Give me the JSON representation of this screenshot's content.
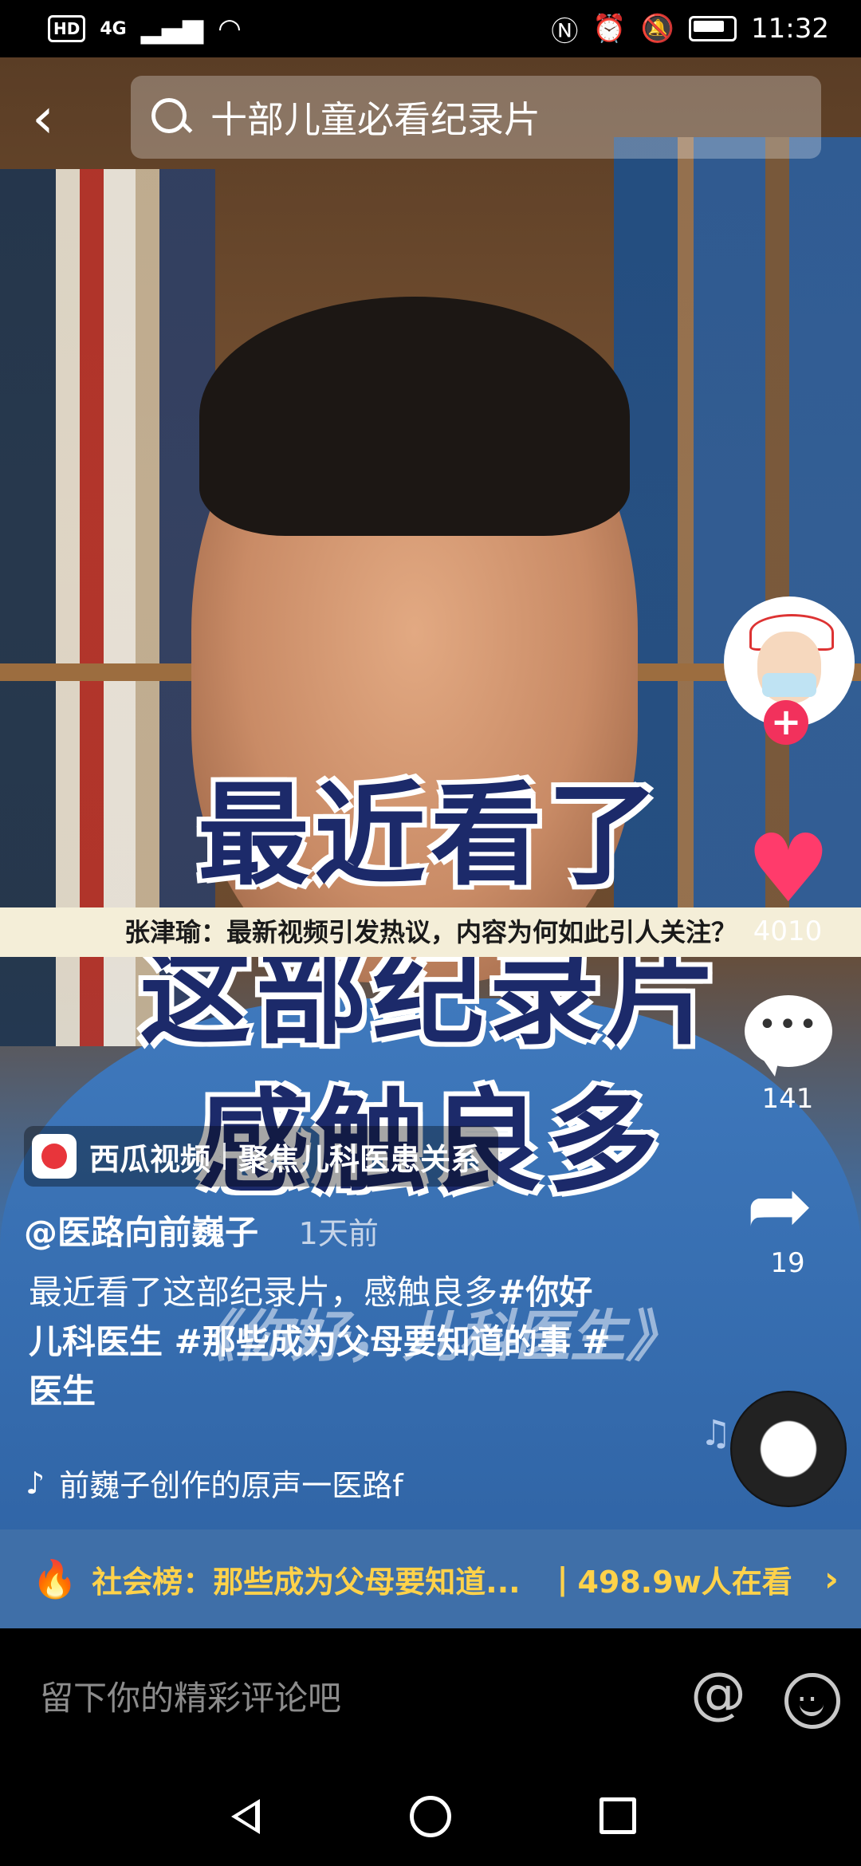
{
  "status_bar": {
    "hd": "HD",
    "network": "4G",
    "time": "11:32"
  },
  "search": {
    "query": "十部儿童必看纪录片"
  },
  "video": {
    "overlay_line1": "最近看了",
    "overlay_line2": "这部纪录片",
    "overlay_line3": "感触良多",
    "subtitle": "《你好，儿科医生》"
  },
  "headline": "张津瑜：最新视频引发热议，内容为何如此引人关注？",
  "rail": {
    "follow_label": "+",
    "like_count": "4010",
    "comment_count": "141",
    "share_count": "19"
  },
  "source": {
    "app_name": "西瓜视频",
    "tagline": "聚焦儿科医患关系"
  },
  "post": {
    "author": "@医路向前巍子",
    "time": "1天前",
    "desc_plain": "最近看了这部纪录片，感触良多",
    "desc_tags": "#你好儿科医生 #那些成为父母要知道的事 #医生",
    "music": "前巍子创作的原声一医路f"
  },
  "ranking": {
    "label": "社会榜：那些成为父母要知道...",
    "viewers": "498.9w人在看"
  },
  "comment": {
    "placeholder": "留下你的精彩评论吧"
  },
  "icons": {
    "back": "chevron-left-icon",
    "search": "search-icon",
    "like": "heart-icon",
    "comment": "comment-bubble-icon",
    "share": "share-arrow-icon",
    "music": "music-note-icon",
    "at": "at-icon",
    "emoji": "emoji-icon"
  }
}
